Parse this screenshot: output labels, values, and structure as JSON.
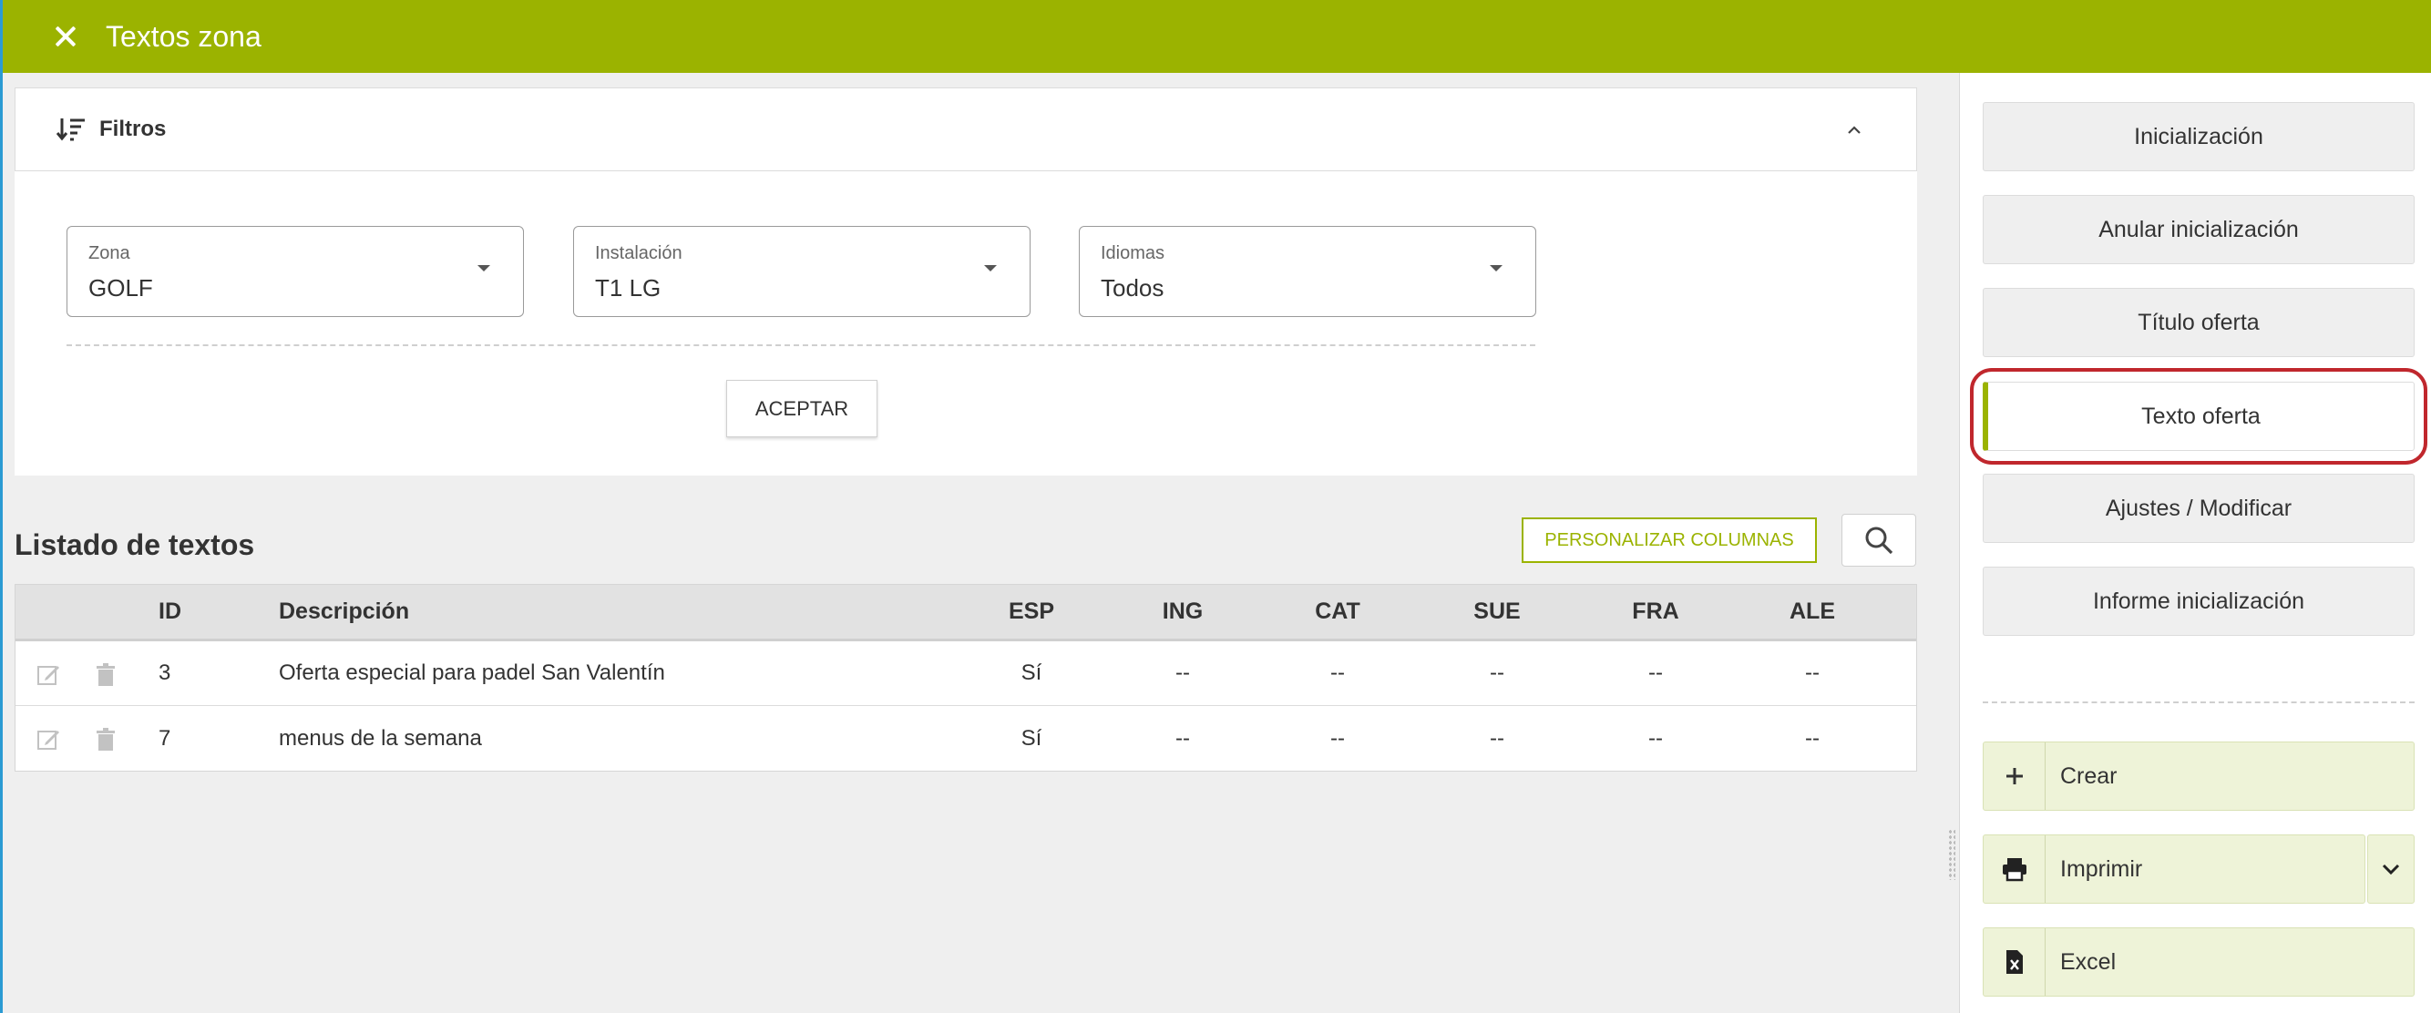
{
  "header": {
    "title": "Textos zona"
  },
  "filters": {
    "label": "Filtros",
    "zona": {
      "label": "Zona",
      "value": "GOLF"
    },
    "instalacion": {
      "label": "Instalación",
      "value": "T1 LG"
    },
    "idiomas": {
      "label": "Idiomas",
      "value": "Todos"
    },
    "accept_label": "ACEPTAR"
  },
  "listing": {
    "title": "Listado de textos",
    "personalize_label": "PERSONALIZAR COLUMNAS",
    "columns": [
      "ID",
      "Descripción",
      "ESP",
      "ING",
      "CAT",
      "SUE",
      "FRA",
      "ALE"
    ],
    "rows": [
      {
        "id": "3",
        "descripcion": "Oferta especial para padel San Valentín",
        "esp": "Sí",
        "ing": "--",
        "cat": "--",
        "sue": "--",
        "fra": "--",
        "ale": "--"
      },
      {
        "id": "7",
        "descripcion": "menus de la semana",
        "esp": "Sí",
        "ing": "--",
        "cat": "--",
        "sue": "--",
        "fra": "--",
        "ale": "--"
      }
    ]
  },
  "actions": {
    "inicializacion": "Inicialización",
    "anular": "Anular inicialización",
    "titulo_oferta": "Título oferta",
    "texto_oferta": "Texto oferta",
    "ajustes": "Ajustes / Modificar",
    "informe": "Informe inicialización",
    "crear": "Crear",
    "imprimir": "Imprimir",
    "excel": "Excel"
  },
  "colors": {
    "brand": "#9bb300",
    "highlight": "#c0272d"
  }
}
